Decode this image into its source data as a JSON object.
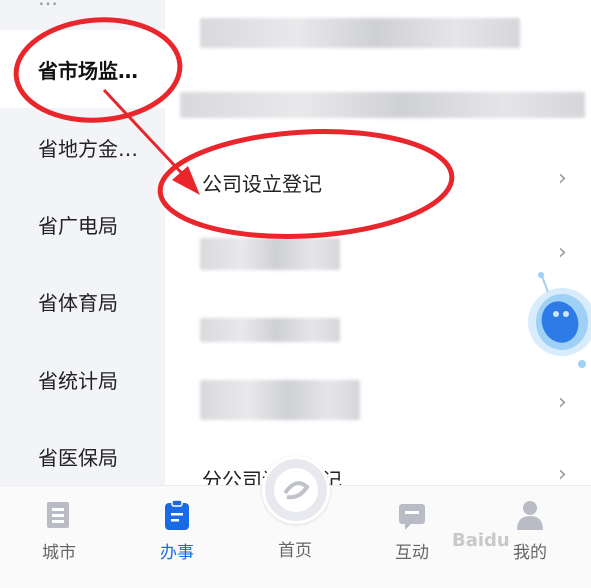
{
  "sidebar": {
    "items": [
      {
        "label": "省市场监…"
      },
      {
        "label": "省地方金…"
      },
      {
        "label": "省广电局"
      },
      {
        "label": "省体育局"
      },
      {
        "label": "省统计局"
      },
      {
        "label": "省医保局"
      }
    ]
  },
  "main": {
    "rows": [
      {
        "label": "公司设立登记"
      },
      {
        "label": "分公司设立登记"
      }
    ],
    "chevron": "›"
  },
  "tabbar": {
    "tabs": [
      {
        "label": "城市",
        "icon": "city-icon"
      },
      {
        "label": "办事",
        "icon": "service-icon"
      },
      {
        "label": "首页",
        "icon": "home-icon"
      },
      {
        "label": "互动",
        "icon": "chat-icon"
      },
      {
        "label": "我的",
        "icon": "profile-icon"
      }
    ]
  },
  "colors": {
    "accent": "#1a6ae6",
    "annotation": "#e8262b",
    "sidebar_bg": "#f3f4f8"
  }
}
